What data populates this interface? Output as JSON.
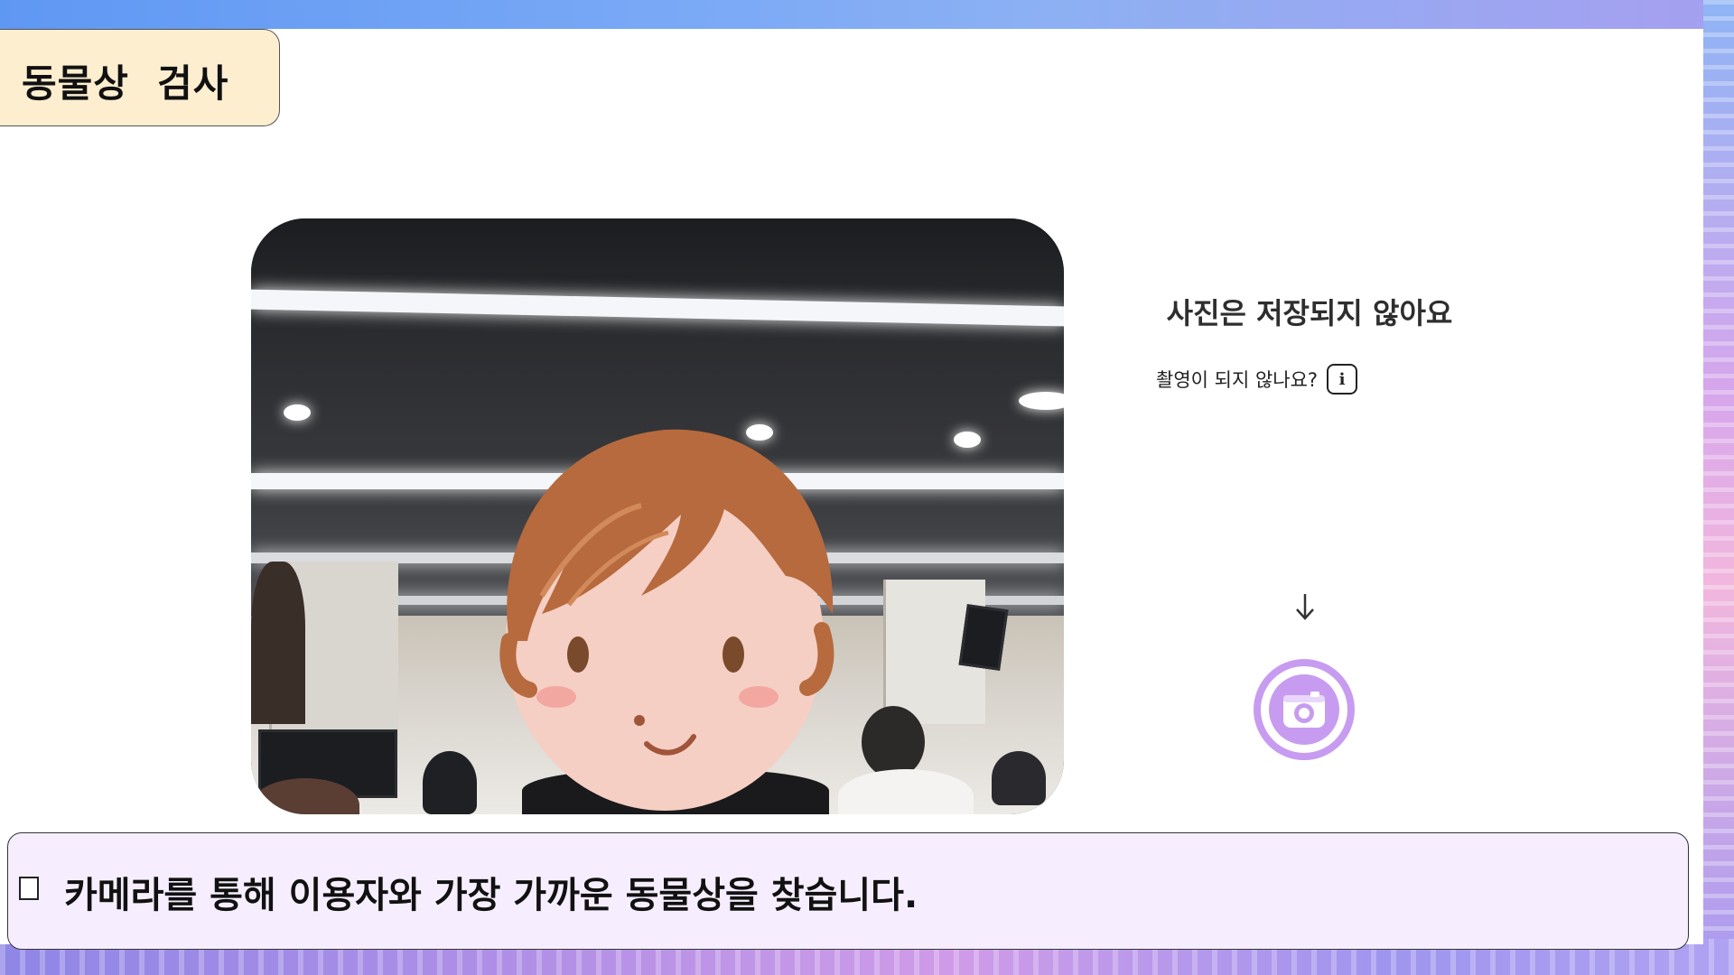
{
  "title": "동물상  검사",
  "camera": {
    "view": "webcam-preview",
    "overlay_icon": "cartoon-face-icon"
  },
  "info": {
    "headline": "사진은 저장되지 않아요",
    "help_text": "촬영이 되지 않나요?",
    "help_icon": "info-icon"
  },
  "capture": {
    "arrow_icon": "arrow-down-icon",
    "button_icon": "camera-icon",
    "accent_color": "#c79cf0"
  },
  "caption": {
    "bullet_icon": "square-bullet-icon",
    "text": "카메라를 통해 이용자와 가장 가까운 동물상을 찾습니다."
  },
  "colors": {
    "title_bg": "#fdeecf",
    "caption_bg": "#f6eefe",
    "accent": "#c79cf0"
  }
}
